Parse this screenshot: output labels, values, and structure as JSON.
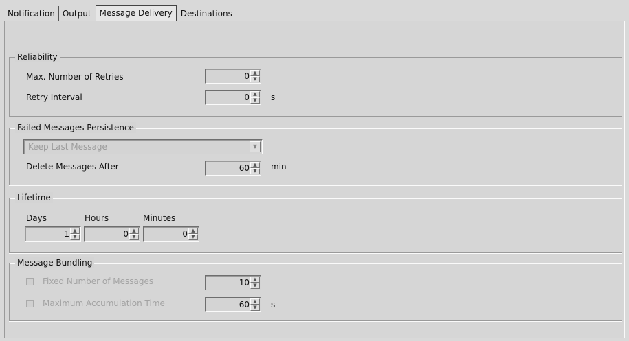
{
  "tabs": [
    {
      "label": "Notification"
    },
    {
      "label": "Output"
    },
    {
      "label": "Message Delivery",
      "active": true
    },
    {
      "label": "Destinations"
    }
  ],
  "reliability": {
    "title": "Reliability",
    "max_retries_label": "Max. Number of Retries",
    "max_retries_value": "0",
    "retry_interval_label": "Retry Interval",
    "retry_interval_value": "0",
    "retry_interval_unit": "s"
  },
  "failed_persistence": {
    "title": "Failed Messages Persistence",
    "mode_selected": "Keep Last Message",
    "delete_after_label": "Delete Messages After",
    "delete_after_value": "60",
    "delete_after_unit": "min"
  },
  "lifetime": {
    "title": "Lifetime",
    "days_label": "Days",
    "days_value": "1",
    "hours_label": "Hours",
    "hours_value": "0",
    "minutes_label": "Minutes",
    "minutes_value": "0"
  },
  "bundling": {
    "title": "Message Bundling",
    "fixed_count_label": "Fixed Number of Messages",
    "fixed_count_value": "10",
    "max_time_label": "Maximum Accumulation Time",
    "max_time_value": "60",
    "max_time_unit": "s"
  },
  "icons": {
    "spin_up": "▲",
    "spin_down": "▼",
    "dropdown": "▼"
  }
}
